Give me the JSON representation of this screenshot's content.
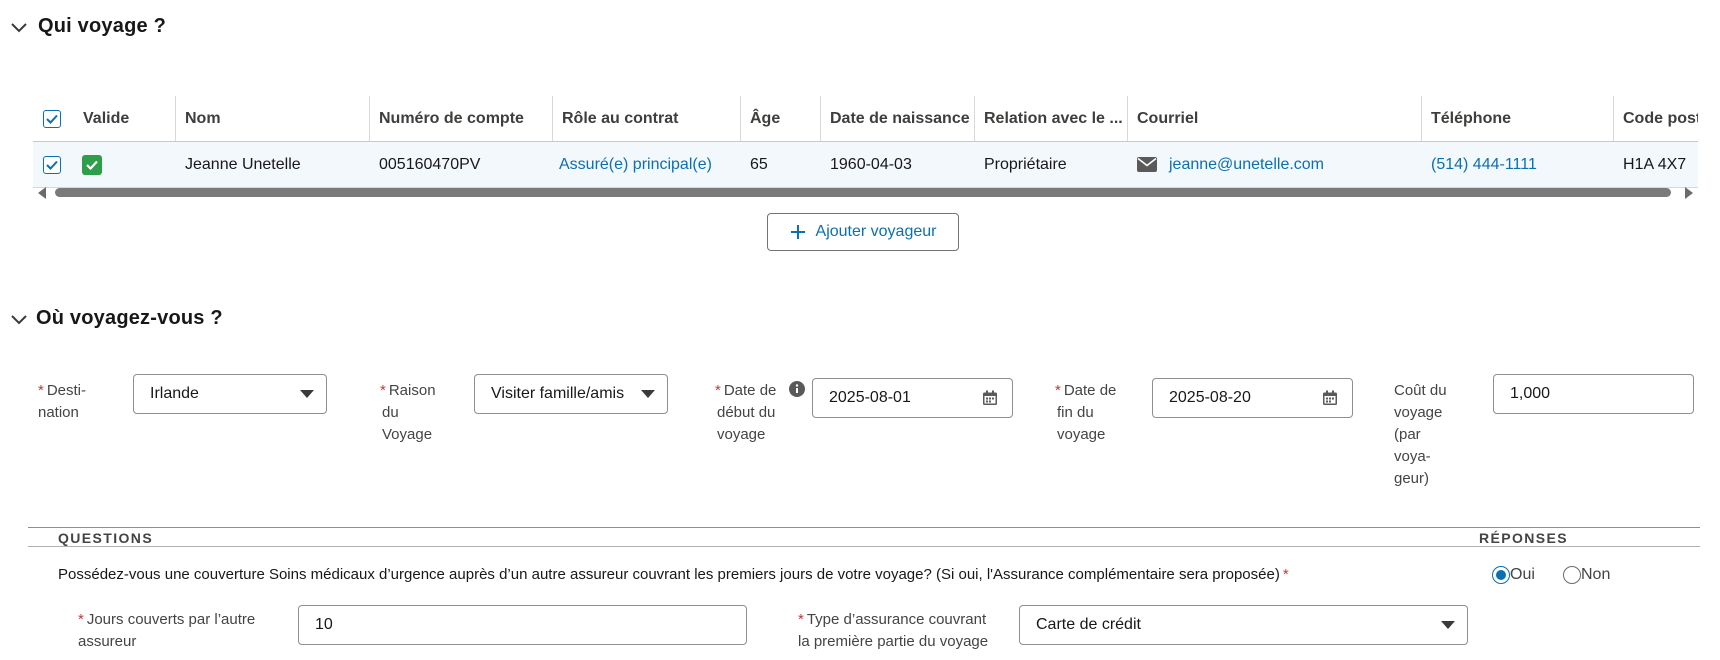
{
  "section1": {
    "title": "Qui voyage ?"
  },
  "table": {
    "headers": [
      "Valide",
      "Nom",
      "Numéro de compte",
      "Rôle au contrat",
      "Âge",
      "Date de naissance",
      "Relation avec le ...",
      "Courriel",
      "Téléphone",
      "Code postal"
    ],
    "row": {
      "nom": "Jeanne Unetelle",
      "compte": "005160470PV",
      "role": "Assuré(e) principal(e)",
      "age": "65",
      "naissance": "1960-04-03",
      "relation": "Propriétaire",
      "courriel": "jeanne@unetelle.com",
      "telephone": "(514) 444-1111",
      "code_postal": "H1A 4X7"
    }
  },
  "add_button": {
    "label": "Ajouter voyageur"
  },
  "section2": {
    "title": "Où voyagez-vous ?"
  },
  "form": {
    "destination": {
      "label_l1": "Desti-",
      "label_l2": "nation",
      "value": "Irlande"
    },
    "raison": {
      "label_l1": "Raison",
      "label_l2": "du",
      "label_l3": "Voyage",
      "value": "Visiter famille/amis"
    },
    "date_debut": {
      "label_l1": "Date de",
      "label_l2": "début du",
      "label_l3": "voyage",
      "value": "2025-08-01"
    },
    "date_fin": {
      "label_l1": "Date de",
      "label_l2": "fin du",
      "label_l3": "voyage",
      "value": "2025-08-20"
    },
    "cout": {
      "label_l1": "Coût du",
      "label_l2": "voyage",
      "label_l3": "(par",
      "label_l4": "voya-",
      "label_l5": "geur)",
      "value": "1,000"
    }
  },
  "questions": {
    "header_q": "QUESTIONS",
    "header_r": "RÉPONSES",
    "q1": "Possédez-vous une couverture Soins médicaux d’urgence auprès d’un autre assureur couvrant les premiers jours de votre voyage? (Si oui, l'Assurance complémentaire sera proposée)",
    "oui": "Oui",
    "non": "Non",
    "jours_label_l1": "Jours couverts par l’autre",
    "jours_label_l2": "assureur",
    "jours_value": "10",
    "type_label_l1": "Type d’assurance couvrant",
    "type_label_l2": "la première partie du voyage",
    "type_value": "Carte de crédit"
  }
}
